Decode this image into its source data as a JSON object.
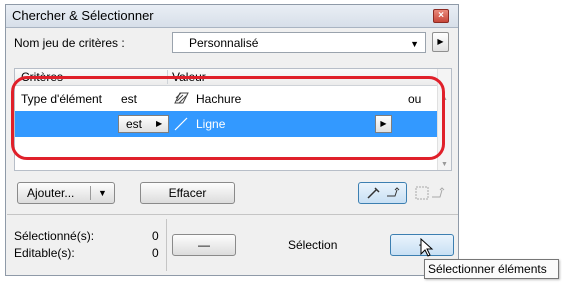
{
  "window": {
    "title": "Chercher & Sélectionner"
  },
  "criteria_set": {
    "label": "Nom jeu de critères :",
    "value": "Personnalisé"
  },
  "table": {
    "headers": {
      "criteria": "Critères",
      "value": "Valeur"
    },
    "rows": [
      {
        "criterion": "Type d'élément",
        "operator": "est",
        "value": "Hachure",
        "connector": "ou",
        "selected": false
      },
      {
        "criterion": "",
        "operator": "est",
        "value": "Ligne",
        "connector": "",
        "selected": true
      }
    ]
  },
  "buttons": {
    "add": "Ajouter...",
    "clear": "Effacer",
    "minus": "—",
    "plus": "+"
  },
  "status": {
    "selected_label": "Sélectionné(s):",
    "selected_count": "0",
    "editable_label": "Editable(s):",
    "editable_count": "0",
    "selection_label": "Sélection"
  },
  "tooltip": "Sélectionner éléments",
  "colors": {
    "highlight": "#3399ff",
    "annotation": "#e0202a"
  },
  "icons": [
    "close-icon",
    "dropdown-arrow-icon",
    "arrow-right-icon",
    "hatch-icon",
    "line-icon",
    "eyedropper-icon",
    "marquee-icon",
    "mouse-cursor-icon"
  ]
}
